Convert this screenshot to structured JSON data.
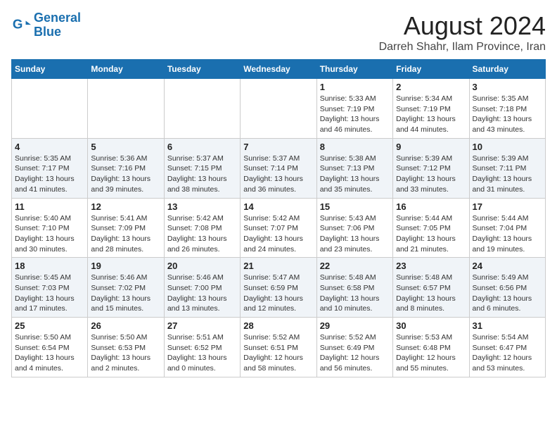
{
  "header": {
    "logo_line1": "General",
    "logo_line2": "Blue",
    "month_title": "August 2024",
    "location": "Darreh Shahr, Ilam Province, Iran"
  },
  "weekdays": [
    "Sunday",
    "Monday",
    "Tuesday",
    "Wednesday",
    "Thursday",
    "Friday",
    "Saturday"
  ],
  "weeks": [
    [
      {
        "day": "",
        "info": ""
      },
      {
        "day": "",
        "info": ""
      },
      {
        "day": "",
        "info": ""
      },
      {
        "day": "",
        "info": ""
      },
      {
        "day": "1",
        "info": "Sunrise: 5:33 AM\nSunset: 7:19 PM\nDaylight: 13 hours\nand 46 minutes."
      },
      {
        "day": "2",
        "info": "Sunrise: 5:34 AM\nSunset: 7:19 PM\nDaylight: 13 hours\nand 44 minutes."
      },
      {
        "day": "3",
        "info": "Sunrise: 5:35 AM\nSunset: 7:18 PM\nDaylight: 13 hours\nand 43 minutes."
      }
    ],
    [
      {
        "day": "4",
        "info": "Sunrise: 5:35 AM\nSunset: 7:17 PM\nDaylight: 13 hours\nand 41 minutes."
      },
      {
        "day": "5",
        "info": "Sunrise: 5:36 AM\nSunset: 7:16 PM\nDaylight: 13 hours\nand 39 minutes."
      },
      {
        "day": "6",
        "info": "Sunrise: 5:37 AM\nSunset: 7:15 PM\nDaylight: 13 hours\nand 38 minutes."
      },
      {
        "day": "7",
        "info": "Sunrise: 5:37 AM\nSunset: 7:14 PM\nDaylight: 13 hours\nand 36 minutes."
      },
      {
        "day": "8",
        "info": "Sunrise: 5:38 AM\nSunset: 7:13 PM\nDaylight: 13 hours\nand 35 minutes."
      },
      {
        "day": "9",
        "info": "Sunrise: 5:39 AM\nSunset: 7:12 PM\nDaylight: 13 hours\nand 33 minutes."
      },
      {
        "day": "10",
        "info": "Sunrise: 5:39 AM\nSunset: 7:11 PM\nDaylight: 13 hours\nand 31 minutes."
      }
    ],
    [
      {
        "day": "11",
        "info": "Sunrise: 5:40 AM\nSunset: 7:10 PM\nDaylight: 13 hours\nand 30 minutes."
      },
      {
        "day": "12",
        "info": "Sunrise: 5:41 AM\nSunset: 7:09 PM\nDaylight: 13 hours\nand 28 minutes."
      },
      {
        "day": "13",
        "info": "Sunrise: 5:42 AM\nSunset: 7:08 PM\nDaylight: 13 hours\nand 26 minutes."
      },
      {
        "day": "14",
        "info": "Sunrise: 5:42 AM\nSunset: 7:07 PM\nDaylight: 13 hours\nand 24 minutes."
      },
      {
        "day": "15",
        "info": "Sunrise: 5:43 AM\nSunset: 7:06 PM\nDaylight: 13 hours\nand 23 minutes."
      },
      {
        "day": "16",
        "info": "Sunrise: 5:44 AM\nSunset: 7:05 PM\nDaylight: 13 hours\nand 21 minutes."
      },
      {
        "day": "17",
        "info": "Sunrise: 5:44 AM\nSunset: 7:04 PM\nDaylight: 13 hours\nand 19 minutes."
      }
    ],
    [
      {
        "day": "18",
        "info": "Sunrise: 5:45 AM\nSunset: 7:03 PM\nDaylight: 13 hours\nand 17 minutes."
      },
      {
        "day": "19",
        "info": "Sunrise: 5:46 AM\nSunset: 7:02 PM\nDaylight: 13 hours\nand 15 minutes."
      },
      {
        "day": "20",
        "info": "Sunrise: 5:46 AM\nSunset: 7:00 PM\nDaylight: 13 hours\nand 13 minutes."
      },
      {
        "day": "21",
        "info": "Sunrise: 5:47 AM\nSunset: 6:59 PM\nDaylight: 13 hours\nand 12 minutes."
      },
      {
        "day": "22",
        "info": "Sunrise: 5:48 AM\nSunset: 6:58 PM\nDaylight: 13 hours\nand 10 minutes."
      },
      {
        "day": "23",
        "info": "Sunrise: 5:48 AM\nSunset: 6:57 PM\nDaylight: 13 hours\nand 8 minutes."
      },
      {
        "day": "24",
        "info": "Sunrise: 5:49 AM\nSunset: 6:56 PM\nDaylight: 13 hours\nand 6 minutes."
      }
    ],
    [
      {
        "day": "25",
        "info": "Sunrise: 5:50 AM\nSunset: 6:54 PM\nDaylight: 13 hours\nand 4 minutes."
      },
      {
        "day": "26",
        "info": "Sunrise: 5:50 AM\nSunset: 6:53 PM\nDaylight: 13 hours\nand 2 minutes."
      },
      {
        "day": "27",
        "info": "Sunrise: 5:51 AM\nSunset: 6:52 PM\nDaylight: 13 hours\nand 0 minutes."
      },
      {
        "day": "28",
        "info": "Sunrise: 5:52 AM\nSunset: 6:51 PM\nDaylight: 12 hours\nand 58 minutes."
      },
      {
        "day": "29",
        "info": "Sunrise: 5:52 AM\nSunset: 6:49 PM\nDaylight: 12 hours\nand 56 minutes."
      },
      {
        "day": "30",
        "info": "Sunrise: 5:53 AM\nSunset: 6:48 PM\nDaylight: 12 hours\nand 55 minutes."
      },
      {
        "day": "31",
        "info": "Sunrise: 5:54 AM\nSunset: 6:47 PM\nDaylight: 12 hours\nand 53 minutes."
      }
    ]
  ]
}
